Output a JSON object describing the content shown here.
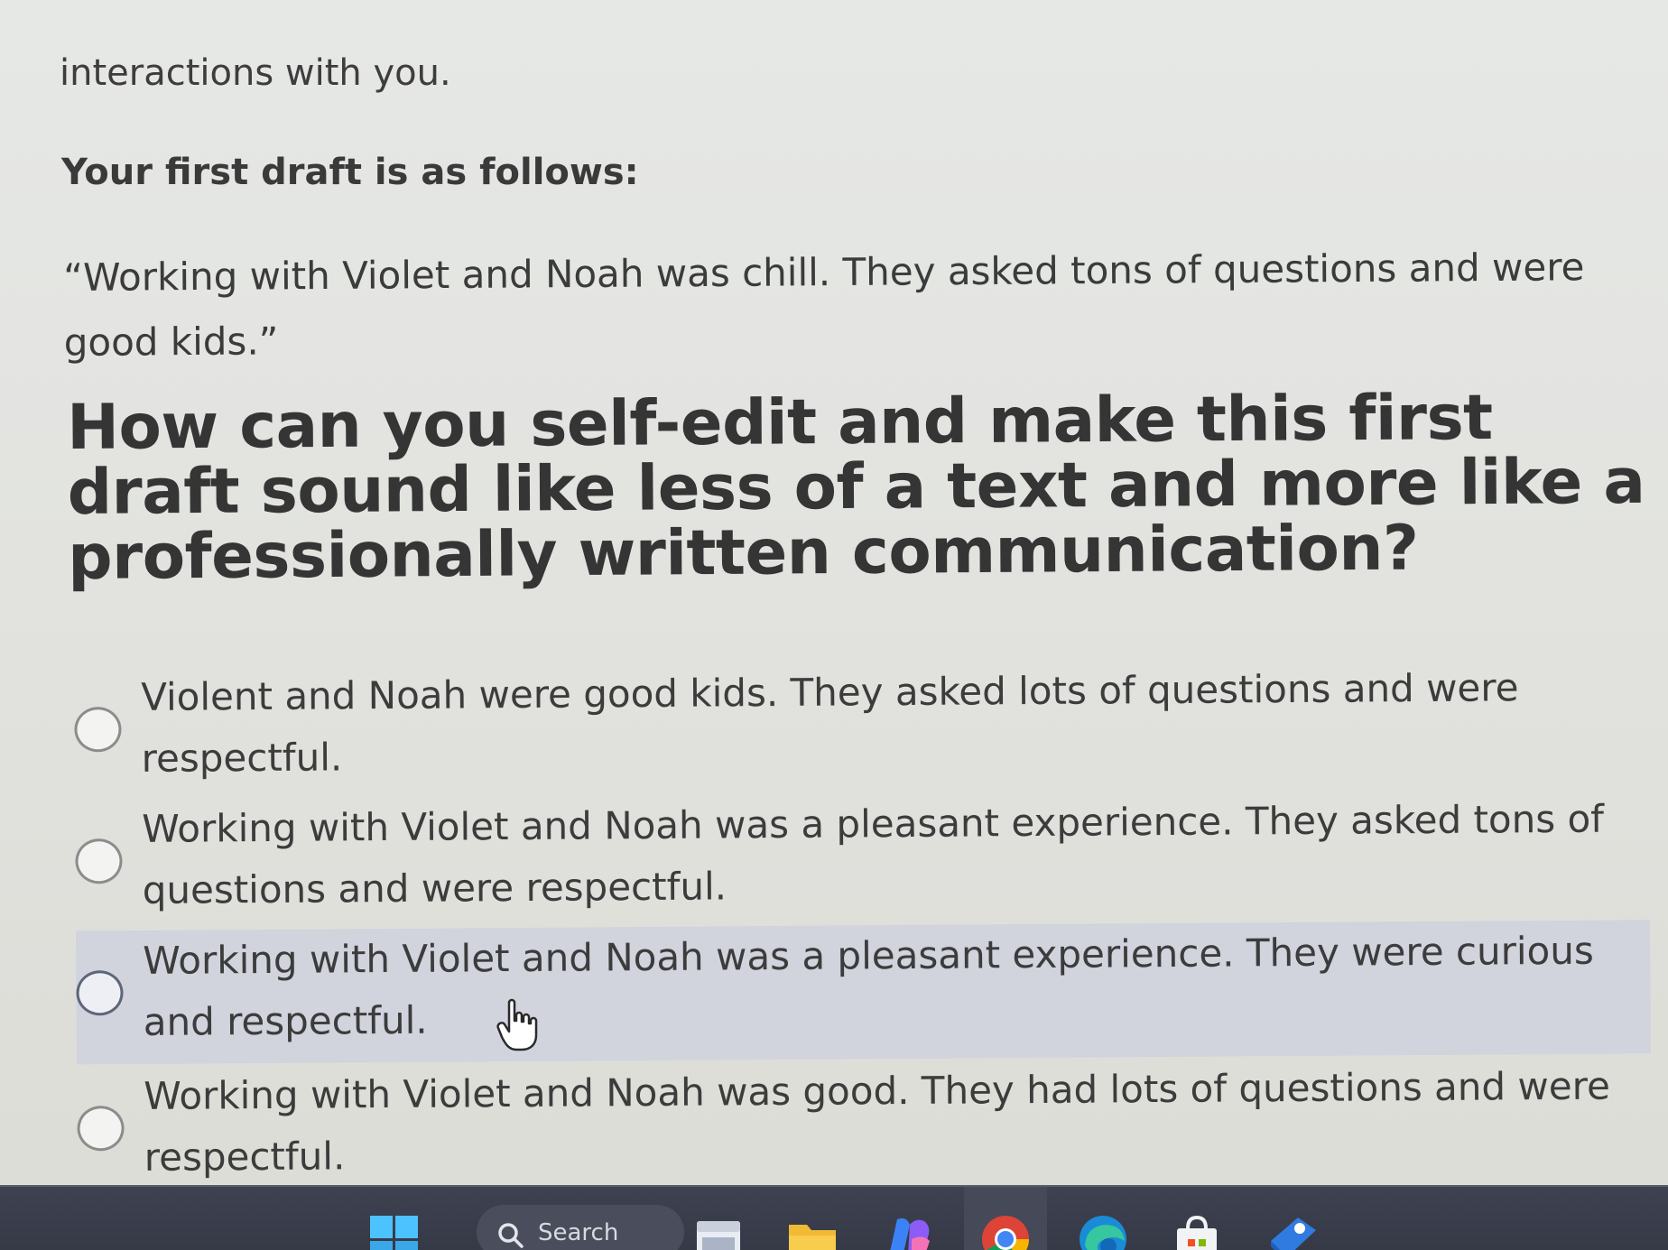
{
  "content": {
    "intro_text": "interactions with you.",
    "draft_heading": "Your first draft is as follows:",
    "draft_quote": "“Working with Violet and Noah was chill. They asked tons of questions and were good kids.”",
    "question": "How can you self-edit and make this first draft sound like less of a text and more like a professionally written communication?"
  },
  "options": [
    {
      "text": "Violent and Noah were good kids. They asked lots of questions and were respectful.",
      "highlighted": false
    },
    {
      "text": "Working with Violet and Noah was a pleasant experience. They asked tons of questions and were respectful.",
      "highlighted": false
    },
    {
      "text": "Working with Violet and Noah was a pleasant experience. They were curious and respectful.",
      "highlighted": true
    },
    {
      "text": "Working with Violet and Noah was good. They had lots of questions and were respectful.",
      "highlighted": false
    }
  ],
  "taskbar": {
    "search_label": "Search",
    "icons": [
      "windows-start-icon",
      "search-icon",
      "file-explorer-icon",
      "folder-icon",
      "copilot-icon",
      "chrome-icon",
      "edge-icon",
      "store-icon",
      "app-icon"
    ]
  },
  "colors": {
    "highlight": "#d1d3dd",
    "taskbar": "#3e4150",
    "text": "#3c3c3c"
  }
}
